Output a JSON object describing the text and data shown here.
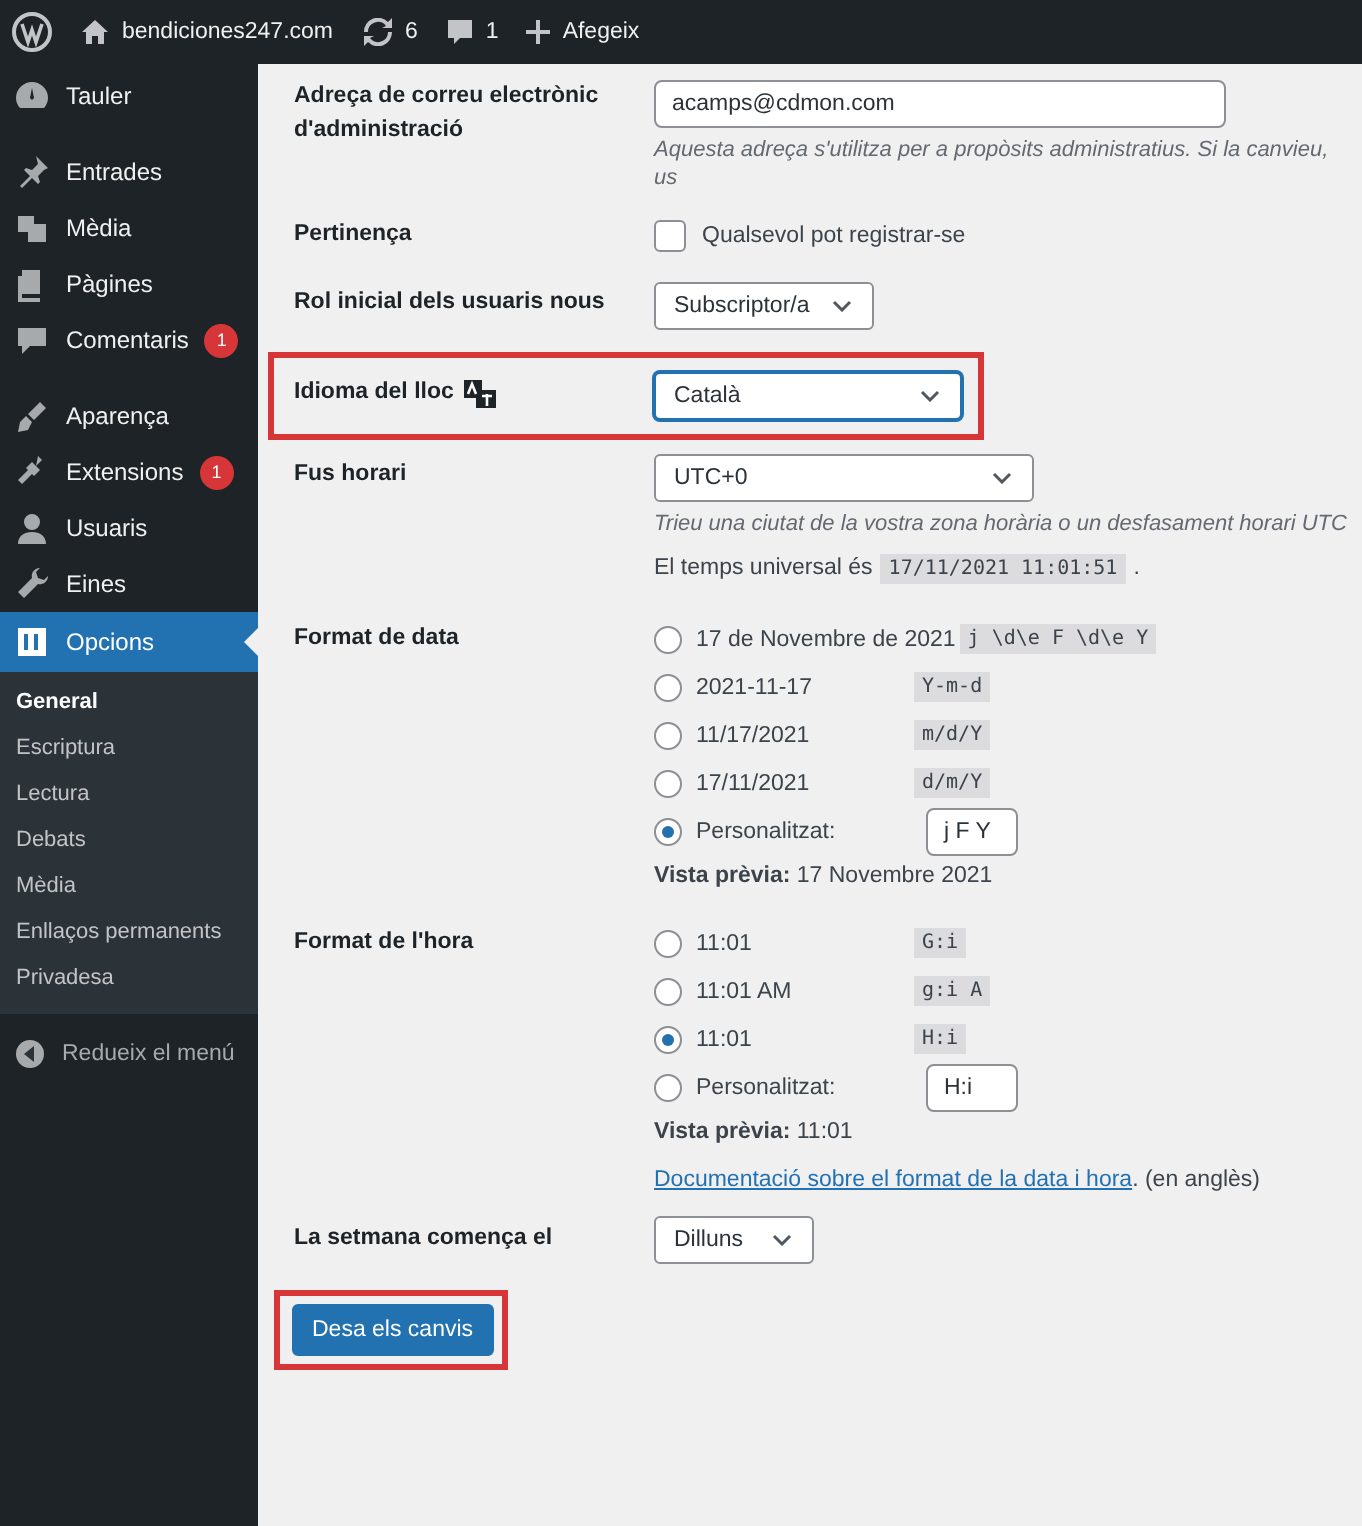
{
  "admin_bar": {
    "site": "bendiciones247.com",
    "updates": "6",
    "comments": "1",
    "new_label": "Afegeix"
  },
  "sidebar": {
    "items": [
      {
        "label": "Tauler",
        "selected": false
      },
      {
        "label": "Entrades",
        "selected": false
      },
      {
        "label": "Mèdia",
        "selected": false
      },
      {
        "label": "Pàgines",
        "selected": false
      },
      {
        "label": "Comentaris",
        "badge": "1",
        "selected": false
      },
      {
        "label": "Aparença",
        "selected": false
      },
      {
        "label": "Extensions",
        "badge": "1",
        "selected": false
      },
      {
        "label": "Usuaris",
        "selected": false
      },
      {
        "label": "Eines",
        "selected": false
      },
      {
        "label": "Opcions",
        "selected": true
      }
    ],
    "submenu": [
      {
        "label": "General",
        "selected": true
      },
      {
        "label": "Escriptura",
        "selected": false
      },
      {
        "label": "Lectura",
        "selected": false
      },
      {
        "label": "Debats",
        "selected": false
      },
      {
        "label": "Mèdia",
        "selected": false
      },
      {
        "label": "Enllaços permanents",
        "selected": false
      },
      {
        "label": "Privadesa",
        "selected": false
      }
    ],
    "collapse": "Redueix el menú"
  },
  "rows": [
    {
      "kind": "text",
      "label": "Adreça de correu electrònic d'administració",
      "value": "acamps@cdmon.com",
      "description": "Aquesta adreça s'utilitza per a propòsits administratius. Si la canvieu, us"
    },
    {
      "kind": "checkbox",
      "label": "Pertinença",
      "option": "Qualsevol pot registrar-se",
      "checked": false
    },
    {
      "kind": "select",
      "label": "Rol inicial dels usuaris nous",
      "value": "Subscriptor/a"
    },
    {
      "kind": "language",
      "label": "Idioma del lloc",
      "value": "Català",
      "highlighted": true
    },
    {
      "kind": "timezone",
      "label": "Fus horari",
      "value": "UTC+0",
      "description": "Trieu una ciutat de la vostra zona horària o un desfasament horari UTC",
      "utc_prefix": "El temps universal és",
      "utc_time": "17/11/2021 11:01:51",
      "utc_suffix": "."
    },
    {
      "kind": "radios",
      "label": "Format de data",
      "options": [
        {
          "text": "17 de Novembre de 2021",
          "code": "j \\d\\e F \\d\\e Y",
          "selected": false
        },
        {
          "text": "2021-11-17",
          "code": "Y-m-d",
          "selected": false
        },
        {
          "text": "11/17/2021",
          "code": "m/d/Y",
          "selected": false
        },
        {
          "text": "17/11/2021",
          "code": "d/m/Y",
          "selected": false
        },
        {
          "text": "Personalitzat:",
          "custom": "j F Y",
          "selected": true
        }
      ],
      "preview": "**Vista prèvia:** 17 Novembre 2021"
    },
    {
      "kind": "radios",
      "label": "Format de l'hora",
      "options": [
        {
          "text": "11:01",
          "code": "G:i",
          "selected": false
        },
        {
          "text": "11:01 AM",
          "code": "g:i A",
          "selected": false
        },
        {
          "text": "11:01",
          "code": "H:i",
          "selected": true
        },
        {
          "text": "Personalitzat:",
          "custom": "H:i",
          "selected": false
        }
      ],
      "preview": "**Vista prèvia:** 11:01",
      "doc_link": "Documentació sobre el format de la data i hora",
      "doc_note": ". (en anglès)"
    },
    {
      "kind": "select",
      "label": "La setmana comença el",
      "value": "Dilluns"
    }
  ],
  "save_button": {
    "label": "Desa els canvis",
    "highlighted": true
  }
}
